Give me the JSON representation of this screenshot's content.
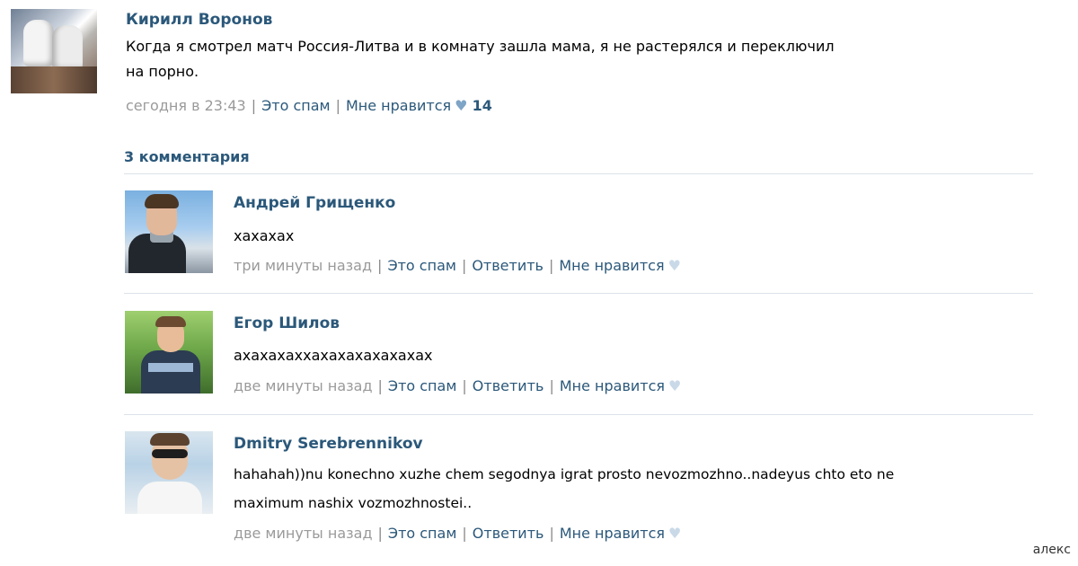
{
  "post": {
    "author": "Кирилл Воронов",
    "text_line1": "Когда я смотрел матч Россия-Литва и в комнату зашла мама, я не растерялся и переключил",
    "text_line2": "на порно.",
    "time": "сегодня в 23:43",
    "spam_label": "Это спам",
    "like_label": "Мне нравится",
    "like_count": "14",
    "avatar_icon": "avatar-photo"
  },
  "comments_header": "3 комментария",
  "comments": [
    {
      "author": "Андрей Грищенко",
      "text_line1": "хахахах",
      "text_line2": "",
      "time": "три минуты назад",
      "spam_label": "Это спам",
      "reply_label": "Ответить",
      "like_label": "Мне нравится"
    },
    {
      "author": "Егор Шилов",
      "text_line1": "ахахахаххахахахахахахах",
      "text_line2": "",
      "time": "две минуты назад",
      "spam_label": "Это спам",
      "reply_label": "Ответить",
      "like_label": "Мне нравится"
    },
    {
      "author": "Dmitry Serebrennikov",
      "text_line1": "hahahah))nu konechno xuzhe chem segodnya igrat prosto nevozmozhno..nadeyus chto eto ne",
      "text_line2": "maximum nashix vozmozhnostei..",
      "time": "две минуты назад",
      "spam_label": "Это спам",
      "reply_label": "Ответить",
      "like_label": "Мне нравится"
    }
  ],
  "watermark": "алекс",
  "colors": {
    "link": "#2b587a",
    "meta": "#9a9a9a",
    "heart_active": "#7ea4c6",
    "heart_inactive": "#c9d9e8",
    "divider": "#dbe2e8"
  }
}
